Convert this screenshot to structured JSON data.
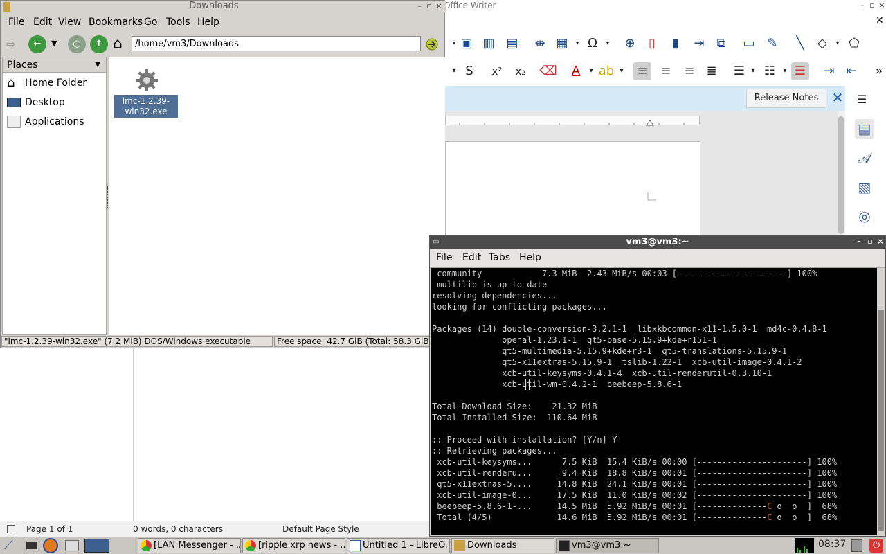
{
  "writer": {
    "title": "Office Writer",
    "infobar_button": "Release Notes",
    "status": {
      "page": "Page 1 of 1",
      "words": "0 words, 0 characters",
      "style": "Default Page Style"
    }
  },
  "filemanager": {
    "title": "Downloads",
    "menu": [
      "File",
      "Edit",
      "View",
      "Bookmarks",
      "Go",
      "Tools",
      "Help"
    ],
    "path": "/home/vm3/Downloads",
    "places_header": "Places",
    "places": [
      "Home Folder",
      "Desktop",
      "Applications"
    ],
    "file": {
      "name_line1": "lmc-1.2.39-",
      "name_line2": "win32.exe"
    },
    "status_left": "\"lmc-1.2.39-win32.exe\" (7.2 MiB) DOS/Windows executable",
    "status_right": "Free space: 42.7 GiB (Total: 58.3 GiB)"
  },
  "terminal": {
    "title": "vm3@vm3:~",
    "menu": [
      "File",
      "Edit",
      "Tabs",
      "Help"
    ],
    "lines": [
      " community            7.3 MiB  2.43 MiB/s 00:03 [----------------------] 100%",
      " multilib is up to date",
      "resolving dependencies...",
      "looking for conflicting packages...",
      "",
      "Packages (14) double-conversion-3.2.1-1  libxkbcommon-x11-1.5.0-1  md4c-0.4.8-1",
      "              openal-1.23.1-1  qt5-base-5.15.9+kde+r151-1",
      "              qt5-multimedia-5.15.9+kde+r3-1  qt5-translations-5.15.9-1",
      "              qt5-x11extras-5.15.9-1  tslib-1.22-1  xcb-util-image-0.4.1-2",
      "              xcb-util-keysyms-0.4.1-4  xcb-util-renderutil-0.3.10-1",
      "              xcb-util-wm-0.4.2-1  beebeep-5.8.6-1",
      "",
      "Total Download Size:    21.32 MiB",
      "Total Installed Size:  110.64 MiB",
      "",
      ":: Proceed with installation? [Y/n] Y",
      ":: Retrieving packages...",
      " xcb-util-keysyms...      7.5 KiB  15.4 KiB/s 00:00 [----------------------] 100%",
      " xcb-util-renderu...      9.4 KiB  18.8 KiB/s 00:01 [----------------------] 100%",
      " qt5-x11extras-5....     14.8 KiB  24.1 KiB/s 00:01 [----------------------] 100%",
      " xcb-util-image-0...     17.5 KiB  11.0 KiB/s 00:02 [----------------------] 100%"
    ],
    "progress_lines": [
      {
        "pre": " beebeep-5.8.6-1-...     14.5 MiB  5.92 MiB/s 00:01 [--------------",
        "mark": "C",
        "post": " o  o  ]  68%"
      },
      {
        "pre": " Total (4/5)             14.6 MiB  5.92 MiB/s 00:01 [--------------",
        "mark": "C",
        "post": " o  o  ]  68%"
      }
    ]
  },
  "taskbar": {
    "tasks": [
      "[LAN Messenger - ...",
      "[ripple xrp news - ...",
      "Untitled 1 - LibreO...",
      "Downloads",
      "vm3@vm3:~"
    ],
    "clock": "08:37"
  }
}
